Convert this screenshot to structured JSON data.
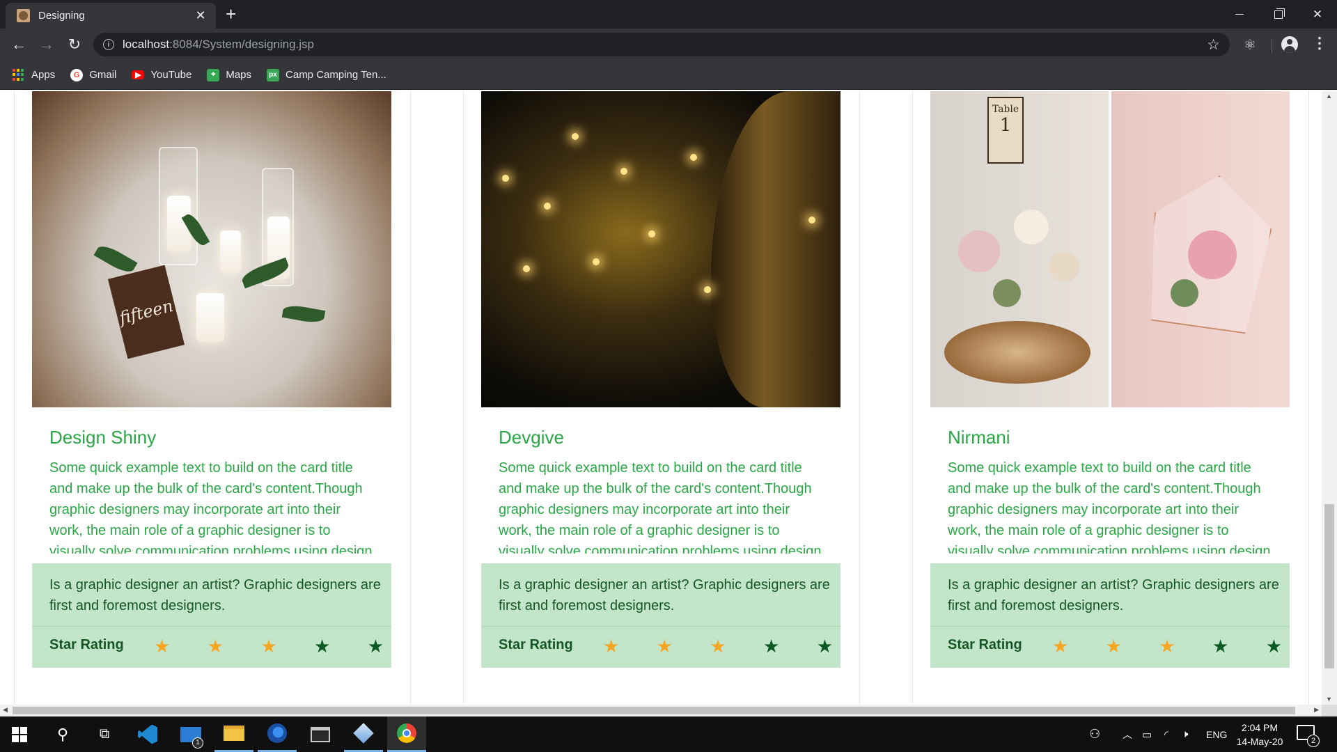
{
  "browser": {
    "tab_title": "Designing",
    "url_host": "localhost",
    "url_rest": ":8084/System/designing.jsp",
    "bookmarks": [
      {
        "label": "Apps",
        "icon": "apps-grid-icon"
      },
      {
        "label": "Gmail",
        "icon": "google-icon"
      },
      {
        "label": "YouTube",
        "icon": "youtube-icon"
      },
      {
        "label": "Maps",
        "icon": "maps-icon"
      },
      {
        "label": "Camp Camping Ten...",
        "icon": "px-icon"
      }
    ]
  },
  "cards": [
    {
      "title": "Design Shiny",
      "text": "Some quick example text to build on the card title and make up the bulk of the card's content.Though graphic designers may incorporate art into their work, the main role of a graphic designer is to visually solve communication problems using design",
      "footer_text": "Is a graphic designer an artist? Graphic designers are first and foremost designers.",
      "rating_label": "Star Rating",
      "rating": 3,
      "rating_max": 5,
      "image": "wedding table centerpiece with candles and greenery, wooden sign"
    },
    {
      "title": "Devgive",
      "text": "Some quick example text to build on the card title and make up the bulk of the card's content.Though graphic designers may incorporate art into their work, the main role of a graphic designer is to visually solve communication problems using design",
      "footer_text": "Is a graphic designer an artist? Graphic designers are first and foremost designers.",
      "rating_label": "Star Rating",
      "rating": 3,
      "rating_max": 5,
      "image": "night garden with hanging lanterns and lit tree"
    },
    {
      "title": "Nirmani",
      "text": "Some quick example text to build on the card title and make up the bulk of the card's content.Though graphic designers may incorporate art into their work, the main role of a graphic designer is to visually solve communication problems using design",
      "footer_text": "Is a graphic designer an artist? Graphic designers are first and foremost designers.",
      "rating_label": "Star Rating",
      "rating": 3,
      "rating_max": 5,
      "image": "floral centerpiece with table number card and geometric terrarium"
    }
  ],
  "colors": {
    "title_green": "#28a745",
    "footer_bg": "#c3e6cb",
    "footer_text": "#155724",
    "star_on": "#f5a623",
    "star_off": "#0b5a24"
  },
  "taskbar": {
    "time": "2:04 PM",
    "date": "14-May-20",
    "language": "ENG",
    "notification_count": "2",
    "mail_badge": "1"
  }
}
